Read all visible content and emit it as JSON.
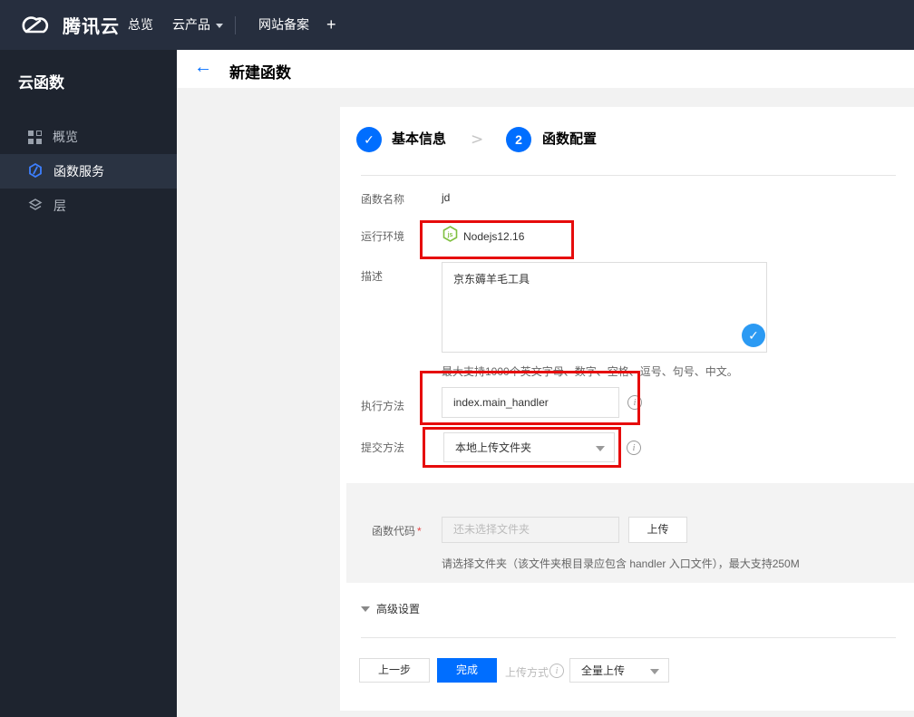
{
  "topbar": {
    "brand": "腾讯云",
    "nav": {
      "overview": "总览",
      "cloud_products": "云产品",
      "icp": "网站备案",
      "add_tab": "+"
    }
  },
  "sidebar": {
    "title": "云函数",
    "items": [
      {
        "label": "概览",
        "icon": "grid-icon",
        "active": false
      },
      {
        "label": "函数服务",
        "icon": "scf-hexagon-icon",
        "active": true
      },
      {
        "label": "层",
        "icon": "layers-icon",
        "active": false
      }
    ]
  },
  "header": {
    "title": "新建函数",
    "back_icon": "←"
  },
  "steps": {
    "step1": {
      "label": "基本信息",
      "state": "done",
      "icon": "check"
    },
    "chevron": ">",
    "step2": {
      "number": "2",
      "label": "函数配置",
      "state": "active"
    }
  },
  "form": {
    "function_name": {
      "label": "函数名称",
      "value": "jd"
    },
    "runtime": {
      "label": "运行环境",
      "value": "Nodejs12.16",
      "icon": "nodejs-icon"
    },
    "description": {
      "label": "描述",
      "value": "京东薅羊毛工具",
      "hint": "最大支持1000个英文字母、数字、空格、逗号、句号、中文。",
      "valid_icon": "check"
    },
    "handler": {
      "label": "执行方法",
      "value": "index.main_handler"
    },
    "submit_method": {
      "label": "提交方法",
      "value": "本地上传文件夹"
    },
    "function_code": {
      "label": "函数代码",
      "required_mark": "*",
      "placeholder": "还未选择文件夹",
      "upload_button": "上传",
      "hint": "请选择文件夹（该文件夹根目录应包含 handler 入口文件），最大支持250M"
    },
    "advanced": {
      "label": "高级设置"
    }
  },
  "footer": {
    "prev_button": "上一步",
    "finish_button": "完成",
    "upload_mode_label": "上传方式",
    "upload_mode_value": "全量上传"
  },
  "icons": {
    "check_glyph": "✓",
    "info_glyph": "i"
  },
  "colors": {
    "accent": "#006eff",
    "annotation_red": "#e60c0c",
    "node_green": "#7fbf3f",
    "topbar_bg": "#262e3e",
    "sidebar_bg": "#1e242f"
  }
}
